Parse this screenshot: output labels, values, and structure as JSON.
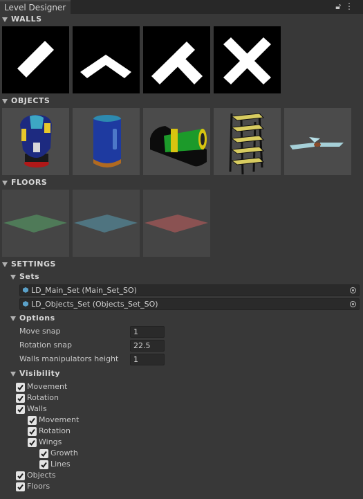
{
  "tab": {
    "title": "Level Designer",
    "icons": [
      "lock-icon",
      "kebab-menu-icon"
    ]
  },
  "sections": {
    "walls": "WALLS",
    "objects": "OBJECTS",
    "floors": "FLOORS",
    "settings": "SETTINGS",
    "sets": "Sets",
    "options": "Options",
    "visibility": "Visibility"
  },
  "walls": [
    "wall-straight",
    "wall-corner",
    "wall-t-junction",
    "wall-cross"
  ],
  "objects": [
    "blue-yellow-robot",
    "blue-canister",
    "green-cylinder-machine",
    "metal-shelf",
    "ceiling-fan"
  ],
  "floors": [
    "green-floor",
    "blue-floor",
    "red-floor"
  ],
  "sets": [
    "LD_Main_Set (Main_Set_SO)",
    "LD_Objects_Set (Objects_Set_SO)"
  ],
  "options": {
    "move_snap_label": "Move snap",
    "move_snap": "1",
    "rotation_snap_label": "Rotation snap",
    "rotation_snap": "22.5",
    "walls_height_label": "Walls manipulators height",
    "walls_height": "1"
  },
  "visibility": [
    {
      "label": "Movement",
      "checked": true
    },
    {
      "label": "Rotation",
      "checked": true
    },
    {
      "label": "Walls",
      "checked": true
    },
    {
      "label": "Movement",
      "checked": true
    },
    {
      "label": "Rotation",
      "checked": true
    },
    {
      "label": "Wings",
      "checked": true
    },
    {
      "label": "Growth",
      "checked": true
    },
    {
      "label": "Lines",
      "checked": true
    },
    {
      "label": "Objects",
      "checked": true
    },
    {
      "label": "Floors",
      "checked": true
    }
  ],
  "colors": {
    "panel_bg": "#383838",
    "field_bg": "#2a2a2a",
    "thumb_bg": "#4b4b4b"
  }
}
